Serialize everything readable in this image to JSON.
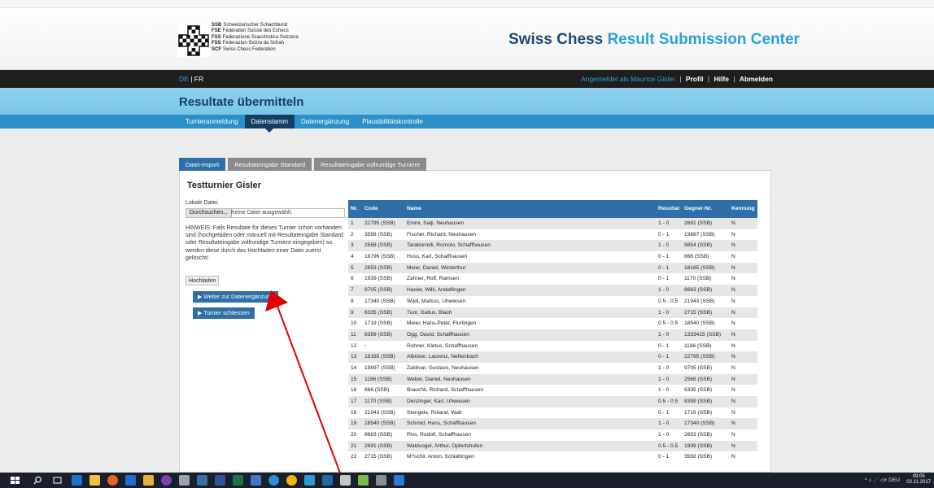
{
  "header": {
    "logo_lines": [
      {
        "abbr": "SSB",
        "text": "Schweizerischer Schachbund"
      },
      {
        "abbr": "FSE",
        "text": "Fédération Suisse des Echecs"
      },
      {
        "abbr": "FSS",
        "text": "Federazione Scacchistica Svizzera"
      },
      {
        "abbr": "FSS",
        "text": "Federaziun Svizra da Schah"
      },
      {
        "abbr": "SCF",
        "text": "Swiss Chess Federation"
      }
    ],
    "title_part1": "Swiss Chess",
    "title_part2": "Result Submission Center"
  },
  "topbar": {
    "lang_de": "DE",
    "lang_sep": "|",
    "lang_fr": "FR",
    "logged_in": "Angemeldet als Maurice Gisler",
    "profile": "Profil",
    "help": "Hilfe",
    "logout": "Abmelden",
    "sep": "|"
  },
  "page": {
    "title": "Resultate übermitteln",
    "nav": [
      "Turnieranmeldung",
      "Datenstamm",
      "Datenergänzung",
      "Plausibilitätskontrolle"
    ],
    "nav_active": "Datenstamm"
  },
  "tabs": [
    "Datei-Import",
    "Resultateingabe Standard",
    "Resultateingabe vollrundige Turniere"
  ],
  "content": {
    "tournament": "Testturnier Gisler",
    "local_file_label": "Lokale Datei:",
    "browse": "Durchsuchen...",
    "no_file": "Keine Datei ausgewählt.",
    "hint": "HINWEIS: Falls Resultate für dieses Turnier schon vorhanden sind (hochgeladen oder manuell mit Resultateingabe Standard oder Resultateingabe vollrundige Turniere eingegeben) so werden diese durch das Hochladen einer Datei zuerst gelöscht!",
    "upload": "Hochladen",
    "btn_continue": "▶ Weiter zur Datenergänzung",
    "btn_close": "▶ Turnier schliessen"
  },
  "table": {
    "headers": [
      "Nr.",
      "Code",
      "Name",
      "Resultat",
      "Gegner-Nr.",
      "Kennung"
    ],
    "rows": [
      [
        "1",
        "22795 (SSB)",
        "Emini, Salji, Neuhausen",
        "1 - 0",
        "2691 (SSB)",
        "N"
      ],
      [
        "2",
        "3558 (SSB)",
        "Fischer, Richard, Neuhausen",
        "0 - 1",
        "19897 (SSB)",
        "N"
      ],
      [
        "3",
        "2568 (SSB)",
        "Taraborrelli, Romolo, Schaffhausen",
        "1 - 0",
        "9854 (SSB)",
        "N"
      ],
      [
        "4",
        "18796 (SSB)",
        "Huss, Karl, Schaffhausen",
        "0 - 1",
        "866 (SSB)",
        "N"
      ],
      [
        "5",
        "2653 (SSB)",
        "Meier, Daniel, Winterthur",
        "0 - 1",
        "18165 (SSB)",
        "N"
      ],
      [
        "6",
        "1939 (SSB)",
        "Zahner, Rolf, Ramsen",
        "0 - 1",
        "1170 (SSB)",
        "N"
      ],
      [
        "7",
        "9705 (SSB)",
        "Hasler, Willi, Andelfingen",
        "1 - 0",
        "8663 (SSB)",
        "N"
      ],
      [
        "8",
        "17340 (SSB)",
        "Wildi, Markus, Uhwiesen",
        "0.5 - 0.5",
        "21943 (SSB)",
        "N"
      ],
      [
        "9",
        "6335 (SSB)",
        "Tuor, Gallus, Blach",
        "1 - 0",
        "2715 (SSB)",
        "N"
      ],
      [
        "10",
        "1719 (SSB)",
        "Meier, Hans-Peter, Flurlingen",
        "0.5 - 0.5",
        "18540 (SSB)",
        "N"
      ],
      [
        "11",
        "8399 (SSB)",
        "Ogg, David, Schaffhausen",
        "1 - 0",
        "1333415 (SSB)",
        "N"
      ],
      [
        "12",
        "-",
        "Rohner, Kletus, Schaffhausen",
        "0 - 1",
        "1186 (SSB)",
        "N"
      ],
      [
        "13",
        "18165 (SSB)",
        "Albicker, Laurenz, Neftenbach",
        "0 - 1",
        "22795 (SSB)",
        "N"
      ],
      [
        "14",
        "19897 (SSB)",
        "Zaldivar, Gustavo, Neuhausen",
        "1 - 0",
        "9705 (SSB)",
        "N"
      ],
      [
        "15",
        "1186 (SSB)",
        "Weber, Daniel, Neuhausen",
        "1 - 0",
        "2568 (SSB)",
        "N"
      ],
      [
        "16",
        "866 (SSB)",
        "Brauchli, Richard, Schaffhausen",
        "1 - 0",
        "6335 (SSB)",
        "N"
      ],
      [
        "17",
        "1170 (SSB)",
        "Denzinger, Karl, Uhwiesen",
        "0.5 - 0.5",
        "8399 (SSB)",
        "N"
      ],
      [
        "18",
        "21943 (SSB)",
        "Stengele, Roland, Watt",
        "0 - 1",
        "1719 (SSB)",
        "N"
      ],
      [
        "19",
        "18540 (SSB)",
        "Schmid, Hans, Schaffhausen",
        "1 - 0",
        "17340 (SSB)",
        "N"
      ],
      [
        "20",
        "8663 (SSB)",
        "Plss, Rudolf, Schaffhausen",
        "1 - 0",
        "2653 (SSB)",
        "N"
      ],
      [
        "21",
        "2691 (SSB)",
        "Waldvogel, Arthur, Opfertshofen",
        "0.5 - 0.5",
        "1939 (SSB)",
        "N"
      ],
      [
        "22",
        "2715 (SSB)",
        "M?schli, Anton, Schlattingen",
        "0 - 1",
        "3558 (SSB)",
        "N"
      ]
    ]
  },
  "taskbar": {
    "tray": "DEU",
    "time": "09:05",
    "date": "02.11.2017"
  },
  "colors": {
    "brand_dark": "#1c4b73",
    "brand_light": "#2aa2d8",
    "tab_active": "#2e6fa7",
    "annotation_arrow": "#e00000"
  }
}
